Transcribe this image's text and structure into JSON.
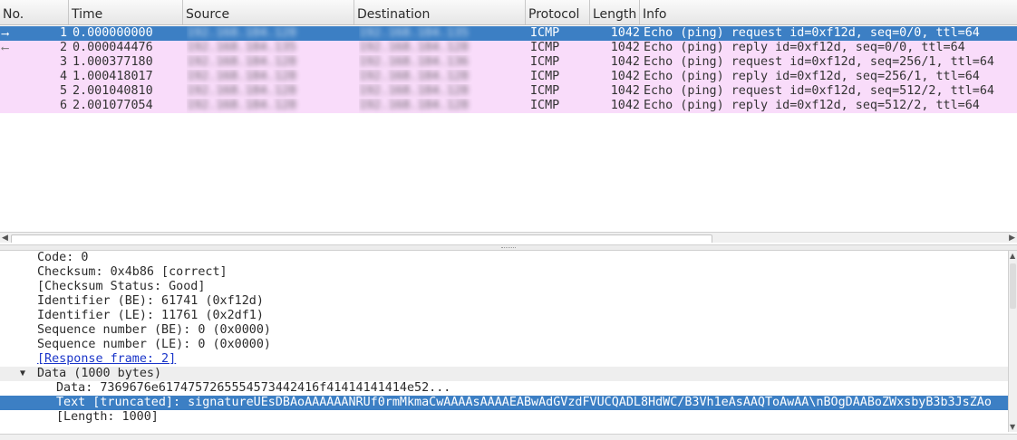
{
  "packet_list": {
    "columns": {
      "no": "No.",
      "time": "Time",
      "source": "Source",
      "destination": "Destination",
      "protocol": "Protocol",
      "length": "Length",
      "info": "Info"
    },
    "rows": [
      {
        "no": "1",
        "time": "0.000000000",
        "source": "192.168.184.128",
        "destination": "192.168.184.135",
        "protocol": "ICMP",
        "length": "1042",
        "info": "Echo (ping) request  id=0xf12d, seq=0/0, ttl=64"
      },
      {
        "no": "2",
        "time": "0.000044476",
        "source": "192.168.184.135",
        "destination": "192.168.184.128",
        "protocol": "ICMP",
        "length": "1042",
        "info": "Echo (ping) reply    id=0xf12d, seq=0/0, ttl=64"
      },
      {
        "no": "3",
        "time": "1.000377180",
        "source": "192.168.184.128",
        "destination": "192.168.184.136",
        "protocol": "ICMP",
        "length": "1042",
        "info": "Echo (ping) request  id=0xf12d, seq=256/1, ttl=64"
      },
      {
        "no": "4",
        "time": "1.000418017",
        "source": "192.168.184.128",
        "destination": "192.168.184.128",
        "protocol": "ICMP",
        "length": "1042",
        "info": "Echo (ping) reply    id=0xf12d, seq=256/1, ttl=64"
      },
      {
        "no": "5",
        "time": "2.001040810",
        "source": "192.168.184.128",
        "destination": "192.168.184.128",
        "protocol": "ICMP",
        "length": "1042",
        "info": "Echo (ping) request  id=0xf12d, seq=512/2, ttl=64"
      },
      {
        "no": "6",
        "time": "2.001077054",
        "source": "192.168.184.128",
        "destination": "192.168.184.128",
        "protocol": "ICMP",
        "length": "1042",
        "info": "Echo (ping) reply    id=0xf12d, seq=512/2, ttl=64"
      }
    ]
  },
  "detail_pane": {
    "lines": [
      {
        "text": "Code: 0"
      },
      {
        "text": "Checksum: 0x4b86 [correct]"
      },
      {
        "text": "[Checksum Status: Good]"
      },
      {
        "text": "Identifier (BE): 61741 (0xf12d)"
      },
      {
        "text": "Identifier (LE): 11761 (0x2df1)"
      },
      {
        "text": "Sequence number (BE): 0 (0x0000)"
      },
      {
        "text": "Sequence number (LE): 0 (0x0000)"
      },
      {
        "text": "[Response frame: 2]"
      },
      {
        "text": "Data (1000 bytes)"
      },
      {
        "text": "Data: 7369676e6174757265554573442416f41414141414e52..."
      },
      {
        "text": "Text [truncated]: signatureUEsDBAoAAAAAANRUf0rmMkmaCwAAAAsAAAAEABwAdGVzdFVUCQADL8HdWC/B3Vh1eAsAAQToAwAA\\nBOgDAABoZWxsbyB3b3JsZAo"
      },
      {
        "text": "[Length: 1000]"
      }
    ]
  },
  "colors": {
    "row_bg": "#f9dcfa",
    "selected_bg": "#3c7fc4",
    "link": "#1a35c9"
  },
  "icons": {
    "request_arrow": "right-arrow-icon",
    "reply_arrow": "left-arrow-icon",
    "expand": "triangle-down-icon"
  }
}
